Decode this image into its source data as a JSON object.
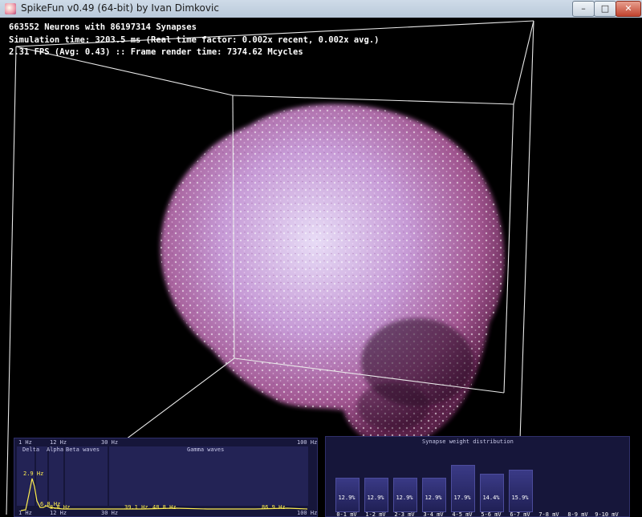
{
  "window": {
    "title": "SpikeFun v0.49 (64-bit) by Ivan Dimkovic",
    "controls": {
      "minimize": "–",
      "maximize": "□",
      "close": "✕"
    }
  },
  "hud": {
    "line1": "663552 Neurons with 86197314 Synapses",
    "line2": "Simulation time: 3203.5 ms (Real time factor: 0.002x recent, 0.002x avg.)",
    "line3": "2.31 FPS (Avg: 0.43) :: Frame render time: 7374.62 Mcycles"
  },
  "wave_panel": {
    "top_ticks": [
      "1 Hz",
      "12 Hz",
      "30 Hz",
      "100 Hz"
    ],
    "bottom_ticks": [
      "1 Hz",
      "12 Hz",
      "30 Hz",
      "100 Hz"
    ],
    "band_labels": {
      "delta": "Delta",
      "alpha": "Alpha",
      "beta": "Beta waves",
      "gamma": "Gamma waves"
    },
    "peak_labels": [
      "2.9 Hz",
      "6.8 Hz",
      "8.8 Hz",
      "39.1 Hz",
      "48.8 Hz",
      "86.9 Hz"
    ]
  },
  "synapse_panel": {
    "title": "Synapse weight distribution",
    "labels": [
      "0-1 mV",
      "1-2 mV",
      "2-3 mV",
      "3-4 mV",
      "4-5 mV",
      "5-6 mV",
      "6-7 mV",
      "7-8 mV",
      "8-9 mV",
      "9-10 mV"
    ],
    "percent_labels": [
      "12.9%",
      "12.9%",
      "12.9%",
      "12.9%",
      "17.9%",
      "14.4%",
      "15.9%",
      "",
      "",
      ""
    ],
    "values": [
      12.9,
      12.9,
      12.9,
      12.9,
      17.9,
      14.4,
      15.9,
      0,
      0,
      0
    ]
  },
  "colors": {
    "panel_bg": "#16163a",
    "wave_line": "#ffef50",
    "bar_fill": "#2c2c70",
    "hud_text": "#ffffff"
  }
}
